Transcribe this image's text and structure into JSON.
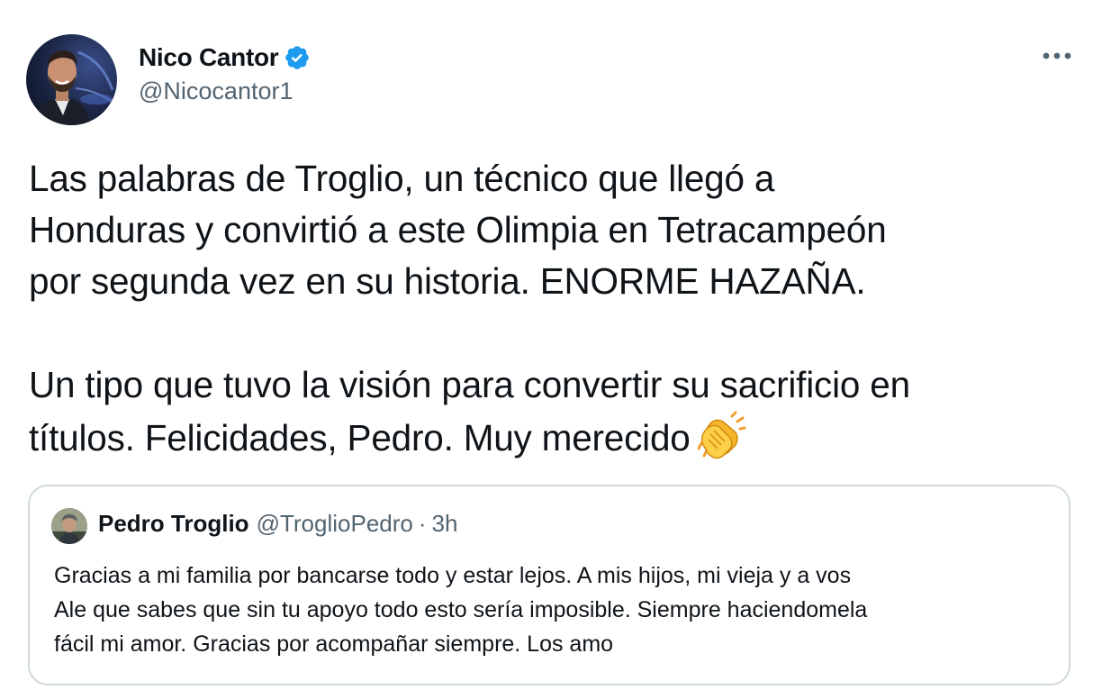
{
  "tweet": {
    "author": {
      "name": "Nico Cantor",
      "handle": "@Nicocantor1",
      "verified": true,
      "avatar_icon": "profile-photo",
      "verified_icon": "verified-badge-icon"
    },
    "more_icon": "more-dots-icon",
    "text_lines": [
      "Las palabras de Troglio, un técnico que llegó a",
      "Honduras y convirtió a este Olimpia en Tetracampeón",
      "por segunda vez en su historia. ENORME HAZAÑA.",
      "Un tipo que tuvo la visión para convertir su sacrificio en",
      "títulos. Felicidades, Pedro. Muy merecido"
    ],
    "emoji_icon": "clapping-hands-icon",
    "quoted": {
      "name": "Pedro Troglio",
      "handle": "@TroglioPedro",
      "separator": "·",
      "time": "3h",
      "text_lines": [
        "Gracias a mi familia por bancarse todo y estar lejos. A mis hijos, mi vieja y a vos",
        "Ale que sabes que sin tu apoyo todo esto sería imposible. Siempre haciendomela",
        "fácil mi amor. Gracias por acompañar siempre. Los amo"
      ]
    }
  },
  "colors": {
    "text_primary": "#0f1419",
    "text_secondary": "#536471",
    "verified_blue": "#1d9bf0",
    "border": "#cfd9de",
    "emoji_yellow": "#f7c22e"
  }
}
